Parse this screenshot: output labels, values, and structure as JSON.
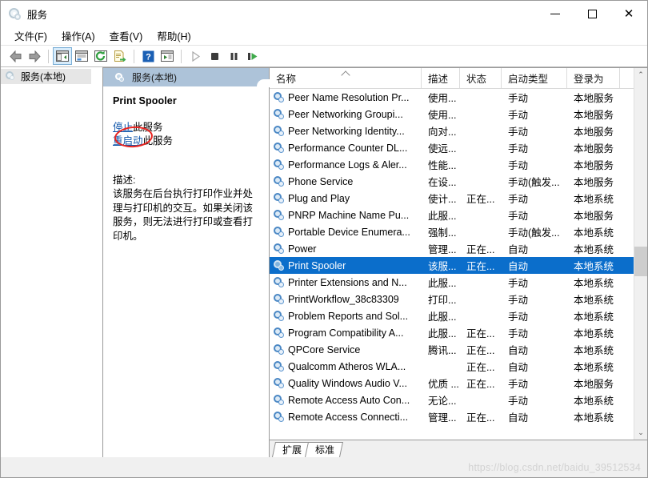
{
  "window": {
    "title": "服务",
    "title_icon": "services-gear-icon",
    "minimize_label": "–",
    "maximize_label": "□",
    "close_label": "✕"
  },
  "menu": {
    "items": [
      {
        "label": "文件(F)",
        "name": "menu-file"
      },
      {
        "label": "操作(A)",
        "name": "menu-action"
      },
      {
        "label": "查看(V)",
        "name": "menu-view"
      },
      {
        "label": "帮助(H)",
        "name": "menu-help"
      }
    ]
  },
  "toolbar": {
    "buttons": [
      {
        "name": "back-icon",
        "tip": "后退"
      },
      {
        "name": "forward-icon",
        "tip": "前进"
      },
      {
        "name": "show-hide-tree-icon",
        "tip": "显示/隐藏控制台树",
        "active": true
      },
      {
        "name": "properties-icon",
        "tip": "属性"
      },
      {
        "name": "refresh-icon",
        "tip": "刷新"
      },
      {
        "name": "export-list-icon",
        "tip": "导出列表"
      },
      {
        "name": "help-icon",
        "tip": "帮助"
      },
      {
        "name": "display-icon",
        "tip": "显示"
      },
      {
        "name": "start-service-icon",
        "tip": "启动服务"
      },
      {
        "name": "stop-service-icon",
        "tip": "停止服务"
      },
      {
        "name": "pause-service-icon",
        "tip": "暂停服务"
      },
      {
        "name": "restart-service-icon",
        "tip": "重启动服务"
      }
    ]
  },
  "tree": {
    "root_label": "服务(本地)",
    "root_icon": "services-gear-icon"
  },
  "details": {
    "header_label": "服务(本地)",
    "header_icon": "services-gear-icon",
    "service_name": "Print Spooler",
    "links": [
      {
        "link_text": "停止",
        "suffix": "此服务",
        "name": "stop-service-link",
        "annotated": true
      },
      {
        "link_text": "重启动",
        "suffix": "此服务",
        "name": "restart-service-link",
        "annotated": false
      }
    ],
    "description_label": "描述:",
    "description_text": "该服务在后台执行打印作业并处理与打印机的交互。如果关闭该服务，则无法进行打印或查看打印机。",
    "annotation_color": "#e8231f"
  },
  "list": {
    "columns": [
      {
        "label": "名称",
        "name": "column-name",
        "sorted": true
      },
      {
        "label": "描述",
        "name": "column-description",
        "sorted": false
      },
      {
        "label": "状态",
        "name": "column-status",
        "sorted": false
      },
      {
        "label": "启动类型",
        "name": "column-startup-type",
        "sorted": false
      },
      {
        "label": "登录为",
        "name": "column-log-on-as",
        "sorted": false
      }
    ],
    "rows": [
      {
        "name": "Peer Name Resolution Pr...",
        "description": "使用...",
        "status": "",
        "startup": "手动",
        "logon": "本地服务",
        "selected": false
      },
      {
        "name": "Peer Networking Groupi...",
        "description": "使用...",
        "status": "",
        "startup": "手动",
        "logon": "本地服务",
        "selected": false
      },
      {
        "name": "Peer Networking Identity...",
        "description": "向对...",
        "status": "",
        "startup": "手动",
        "logon": "本地服务",
        "selected": false
      },
      {
        "name": "Performance Counter DL...",
        "description": "使远...",
        "status": "",
        "startup": "手动",
        "logon": "本地服务",
        "selected": false
      },
      {
        "name": "Performance Logs & Aler...",
        "description": "性能...",
        "status": "",
        "startup": "手动",
        "logon": "本地服务",
        "selected": false
      },
      {
        "name": "Phone Service",
        "description": "在设...",
        "status": "",
        "startup": "手动(触发...",
        "logon": "本地服务",
        "selected": false
      },
      {
        "name": "Plug and Play",
        "description": "使计...",
        "status": "正在...",
        "startup": "手动",
        "logon": "本地系统",
        "selected": false
      },
      {
        "name": "PNRP Machine Name Pu...",
        "description": "此服...",
        "status": "",
        "startup": "手动",
        "logon": "本地服务",
        "selected": false
      },
      {
        "name": "Portable Device Enumera...",
        "description": "强制...",
        "status": "",
        "startup": "手动(触发...",
        "logon": "本地系统",
        "selected": false
      },
      {
        "name": "Power",
        "description": "管理...",
        "status": "正在...",
        "startup": "自动",
        "logon": "本地系统",
        "selected": false
      },
      {
        "name": "Print Spooler",
        "description": "该服...",
        "status": "正在...",
        "startup": "自动",
        "logon": "本地系统",
        "selected": true
      },
      {
        "name": "Printer Extensions and N...",
        "description": "此服...",
        "status": "",
        "startup": "手动",
        "logon": "本地系统",
        "selected": false
      },
      {
        "name": "PrintWorkflow_38c83309",
        "description": "打印...",
        "status": "",
        "startup": "手动",
        "logon": "本地系统",
        "selected": false
      },
      {
        "name": "Problem Reports and Sol...",
        "description": "此服...",
        "status": "",
        "startup": "手动",
        "logon": "本地系统",
        "selected": false
      },
      {
        "name": "Program Compatibility A...",
        "description": "此服...",
        "status": "正在...",
        "startup": "手动",
        "logon": "本地系统",
        "selected": false
      },
      {
        "name": "QPCore Service",
        "description": "腾讯...",
        "status": "正在...",
        "startup": "自动",
        "logon": "本地系统",
        "selected": false
      },
      {
        "name": "Qualcomm Atheros WLA...",
        "description": "",
        "status": "正在...",
        "startup": "自动",
        "logon": "本地系统",
        "selected": false
      },
      {
        "name": "Quality Windows Audio V...",
        "description": "优质 ...",
        "status": "正在...",
        "startup": "手动",
        "logon": "本地服务",
        "selected": false
      },
      {
        "name": "Remote Access Auto Con...",
        "description": "无论...",
        "status": "",
        "startup": "手动",
        "logon": "本地系统",
        "selected": false
      },
      {
        "name": "Remote Access Connecti...",
        "description": "管理...",
        "status": "正在...",
        "startup": "自动",
        "logon": "本地系统",
        "selected": false
      }
    ],
    "selection_color": "#0b6ecb"
  },
  "scrollbar": {
    "up_arrow": "⌃",
    "down_arrow": "⌄"
  },
  "tabs": [
    {
      "label": "扩展",
      "name": "tab-extended"
    },
    {
      "label": "标准",
      "name": "tab-standard"
    }
  ],
  "watermark": "https://blog.csdn.net/baidu_39512534"
}
